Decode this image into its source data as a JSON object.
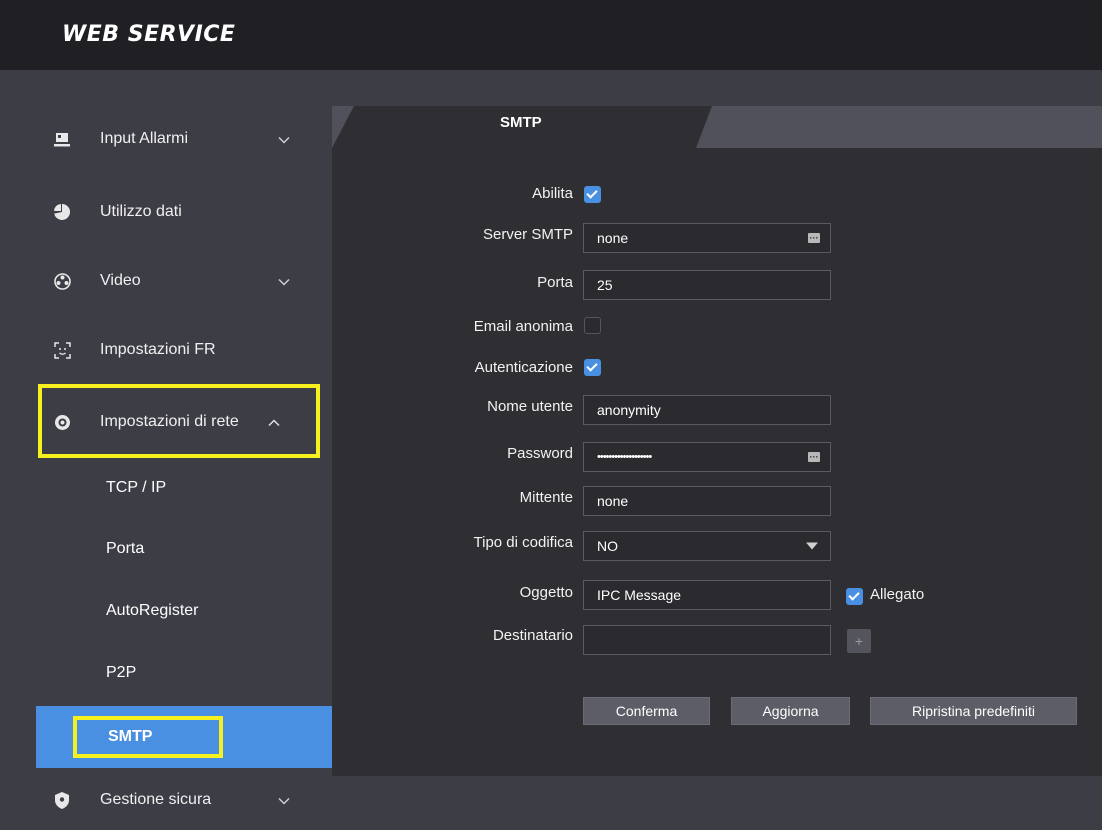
{
  "header": {
    "brand": "WEB SERVICE"
  },
  "sidebar": {
    "items": [
      {
        "label": "Input Allarmi",
        "icon": "alarm-input-icon"
      },
      {
        "label": "Utilizzo dati",
        "icon": "pie-chart-icon"
      },
      {
        "label": "Video",
        "icon": "video-reel-icon"
      },
      {
        "label": "Impostazioni FR",
        "icon": "face-scan-icon"
      },
      {
        "label": "Impostazioni di rete",
        "icon": "network-globe-icon"
      },
      {
        "label": "Gestione sicura",
        "icon": "shield-icon"
      }
    ],
    "subitems": [
      {
        "label": "TCP / IP"
      },
      {
        "label": "Porta"
      },
      {
        "label": "AutoRegister"
      },
      {
        "label": "P2P"
      },
      {
        "label": "SMTP"
      }
    ]
  },
  "main": {
    "tab": "SMTP",
    "form": {
      "enable_label": "Abilita",
      "enable_checked": true,
      "smtp_server_label": "Server SMTP",
      "smtp_server_value": "none",
      "port_label": "Porta",
      "port_value": "25",
      "anonymous_label": "Email anonima",
      "anonymous_checked": false,
      "auth_label": "Autenticazione",
      "auth_checked": true,
      "username_label": "Nome utente",
      "username_value": "anonymity",
      "password_label": "Password",
      "password_value": "•••••••••••••••••••",
      "sender_label": "Mittente",
      "sender_value": "none",
      "encoding_label": "Tipo di codifica",
      "encoding_value": "NO",
      "subject_label": "Oggetto",
      "subject_value": "IPC Message",
      "attachment_label": "Allegato",
      "attachment_checked": true,
      "recipient_label": "Destinatario",
      "recipient_value": "",
      "add_recipient_label": "+"
    },
    "buttons": {
      "confirm": "Conferma",
      "refresh": "Aggiorna",
      "restore": "Ripristina predefiniti"
    }
  },
  "colors": {
    "accent": "#4a90e2",
    "highlight": "#f5f01e",
    "topbar": "#1f1f24",
    "panel": "#2e2e33"
  }
}
